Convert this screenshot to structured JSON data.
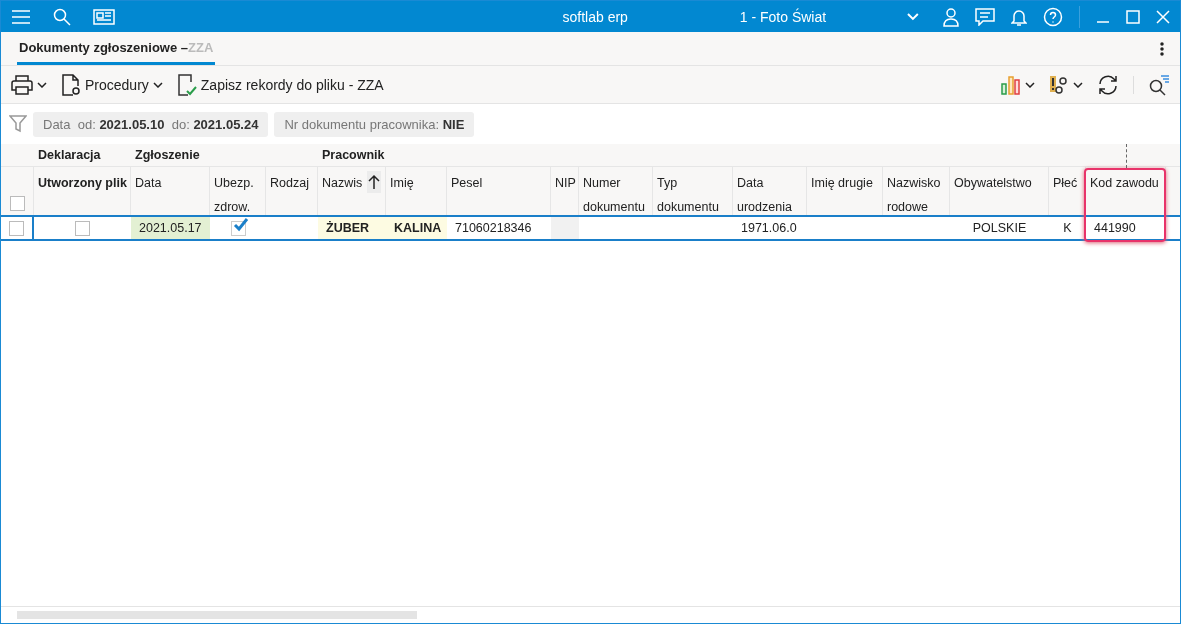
{
  "window": {
    "app_title": "softlab erp",
    "company": "1 - Foto Świat"
  },
  "tabs": [
    {
      "label": "Dokumenty zgłoszeniowe – ",
      "faded": "ZZA",
      "selected": true
    }
  ],
  "toolbar": {
    "procedures": "Procedury",
    "save": "Zapisz rekordy do pliku - ZZA"
  },
  "filters": [
    {
      "parts": [
        {
          "label": "Data  od: ",
          "value": "2021.05.10"
        },
        {
          "label": "  do: ",
          "value": "2021.05.24"
        }
      ]
    },
    {
      "parts": [
        {
          "label": "Nr dokumentu pracownika: ",
          "value": "NIE"
        }
      ]
    }
  ],
  "table": {
    "select_all_checked": false,
    "groups": [
      {
        "label": "Deklaracja",
        "columns": [
          {
            "label": "Utworzony plik"
          }
        ]
      },
      {
        "label": "Zgłoszenie",
        "columns": [
          {
            "label": "Data"
          },
          {
            "label": "Ubezp. zdrow."
          },
          {
            "label": "Rodzaj"
          }
        ]
      },
      {
        "label": "Pracownik",
        "columns": [
          {
            "label": "Nazwis",
            "sorted": true
          },
          {
            "label": "Imię"
          },
          {
            "label": "Pesel"
          },
          {
            "label": "NIP"
          },
          {
            "label": "Numer dokumentu"
          },
          {
            "label": "Typ dokumentu"
          },
          {
            "label": "Data urodzenia"
          },
          {
            "label": "Imię drugie"
          },
          {
            "label": "Nazwisko rodowe"
          },
          {
            "label": "Obywatelstwo"
          },
          {
            "label": "Płeć"
          },
          {
            "label": "Kod zawodu",
            "marked": true
          }
        ]
      }
    ],
    "rows": [
      {
        "selected": false,
        "cells": [
          {
            "kind": "check",
            "checked": false
          },
          {
            "kind": "text",
            "text": "2021.05.17",
            "color": "#e3f0d3"
          },
          {
            "kind": "check",
            "checked": true
          },
          {
            "kind": "text"
          },
          {
            "kind": "text",
            "text": "ŻUBER",
            "bold": true,
            "color": "#fdfbe2"
          },
          {
            "kind": "text",
            "text": "KALINA",
            "bold": true,
            "color": "#fdfbe2"
          },
          {
            "kind": "text",
            "text": "71060218346"
          },
          {
            "kind": "text",
            "color": "#f1f1f1"
          },
          {
            "kind": "text"
          },
          {
            "kind": "text"
          },
          {
            "kind": "text",
            "text": "1971.06.0"
          },
          {
            "kind": "text"
          },
          {
            "kind": "text"
          },
          {
            "kind": "text",
            "text": "POLSKIE",
            "center": true
          },
          {
            "kind": "text",
            "text": "K",
            "center": true
          },
          {
            "kind": "text",
            "text": "441990"
          }
        ]
      }
    ]
  }
}
